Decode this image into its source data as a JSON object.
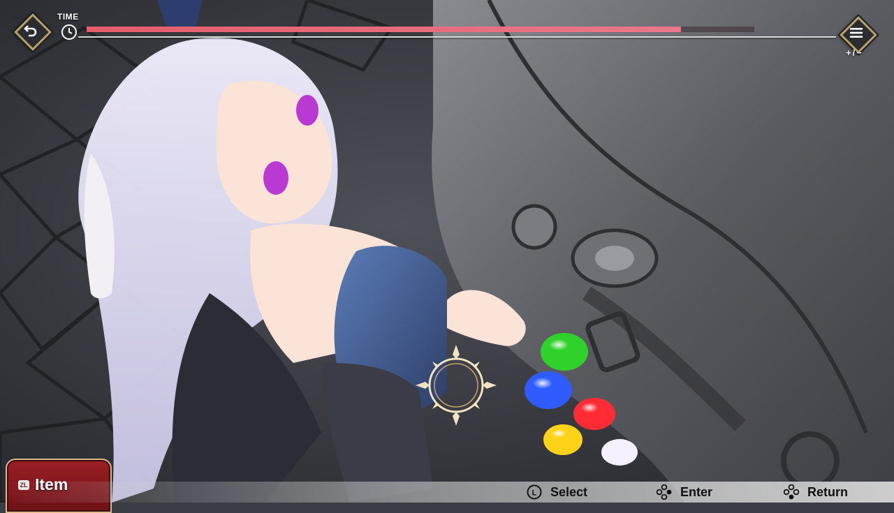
{
  "hud": {
    "time_label": "TIME",
    "timer_remaining_fraction": 0.89,
    "timer_color": "#e45d6a",
    "back_icon": "back-arrow-icon",
    "menu_icon": "menu-icon",
    "zoom_label": "+/−"
  },
  "bottom": {
    "item_button_glyph": "ZL",
    "item_button_label": "Item",
    "hints": [
      {
        "icon": "left-stick-icon",
        "label": "Select"
      },
      {
        "icon": "dpad-right-icon",
        "label": "Enter"
      },
      {
        "icon": "dpad-down-icon",
        "label": "Return"
      }
    ]
  },
  "scene": {
    "orbs": [
      {
        "color_name": "green",
        "color": "#2fd12a"
      },
      {
        "color_name": "blue",
        "color": "#2f5bff"
      },
      {
        "color_name": "red",
        "color": "#ff2b35"
      },
      {
        "color_name": "yellow",
        "color": "#ffd21a"
      },
      {
        "color_name": "white",
        "color": "#f4f0ff"
      }
    ]
  }
}
